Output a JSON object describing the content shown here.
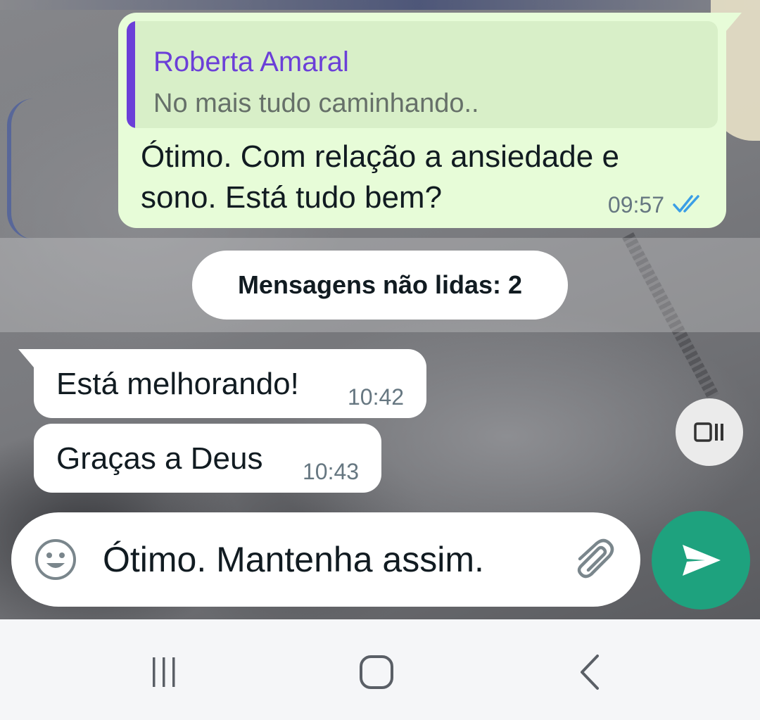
{
  "chat": {
    "outgoing_message": {
      "quote_author": "Roberta Amaral",
      "quote_text": "No mais tudo caminhando..",
      "text": "Ótimo. Com relação a ansiedade e sono. Está tudo bem?",
      "time": "09:57",
      "status_icon": "double-check-read-icon"
    },
    "unread_divider": "Mensagens não lidas: 2",
    "incoming_messages": [
      {
        "text": "Está melhorando!",
        "time": "10:42"
      },
      {
        "text": "Graças a Deus",
        "time": "10:43"
      }
    ]
  },
  "composer": {
    "value": "Ótimo. Mantenha assim.",
    "emoji_icon": "emoji-icon",
    "attach_icon": "paperclip-icon",
    "send_icon": "send-icon",
    "float_icon": "picture-in-picture-icon"
  },
  "navbar": {
    "recent_icon": "recent-apps-icon",
    "home_icon": "home-icon",
    "back_icon": "back-icon"
  },
  "colors": {
    "outgoing_bubble": "#e7fcd8",
    "quote_accent": "#6b3fd8",
    "send_button": "#1ea27e",
    "read_ticks": "#3a9ee6"
  }
}
